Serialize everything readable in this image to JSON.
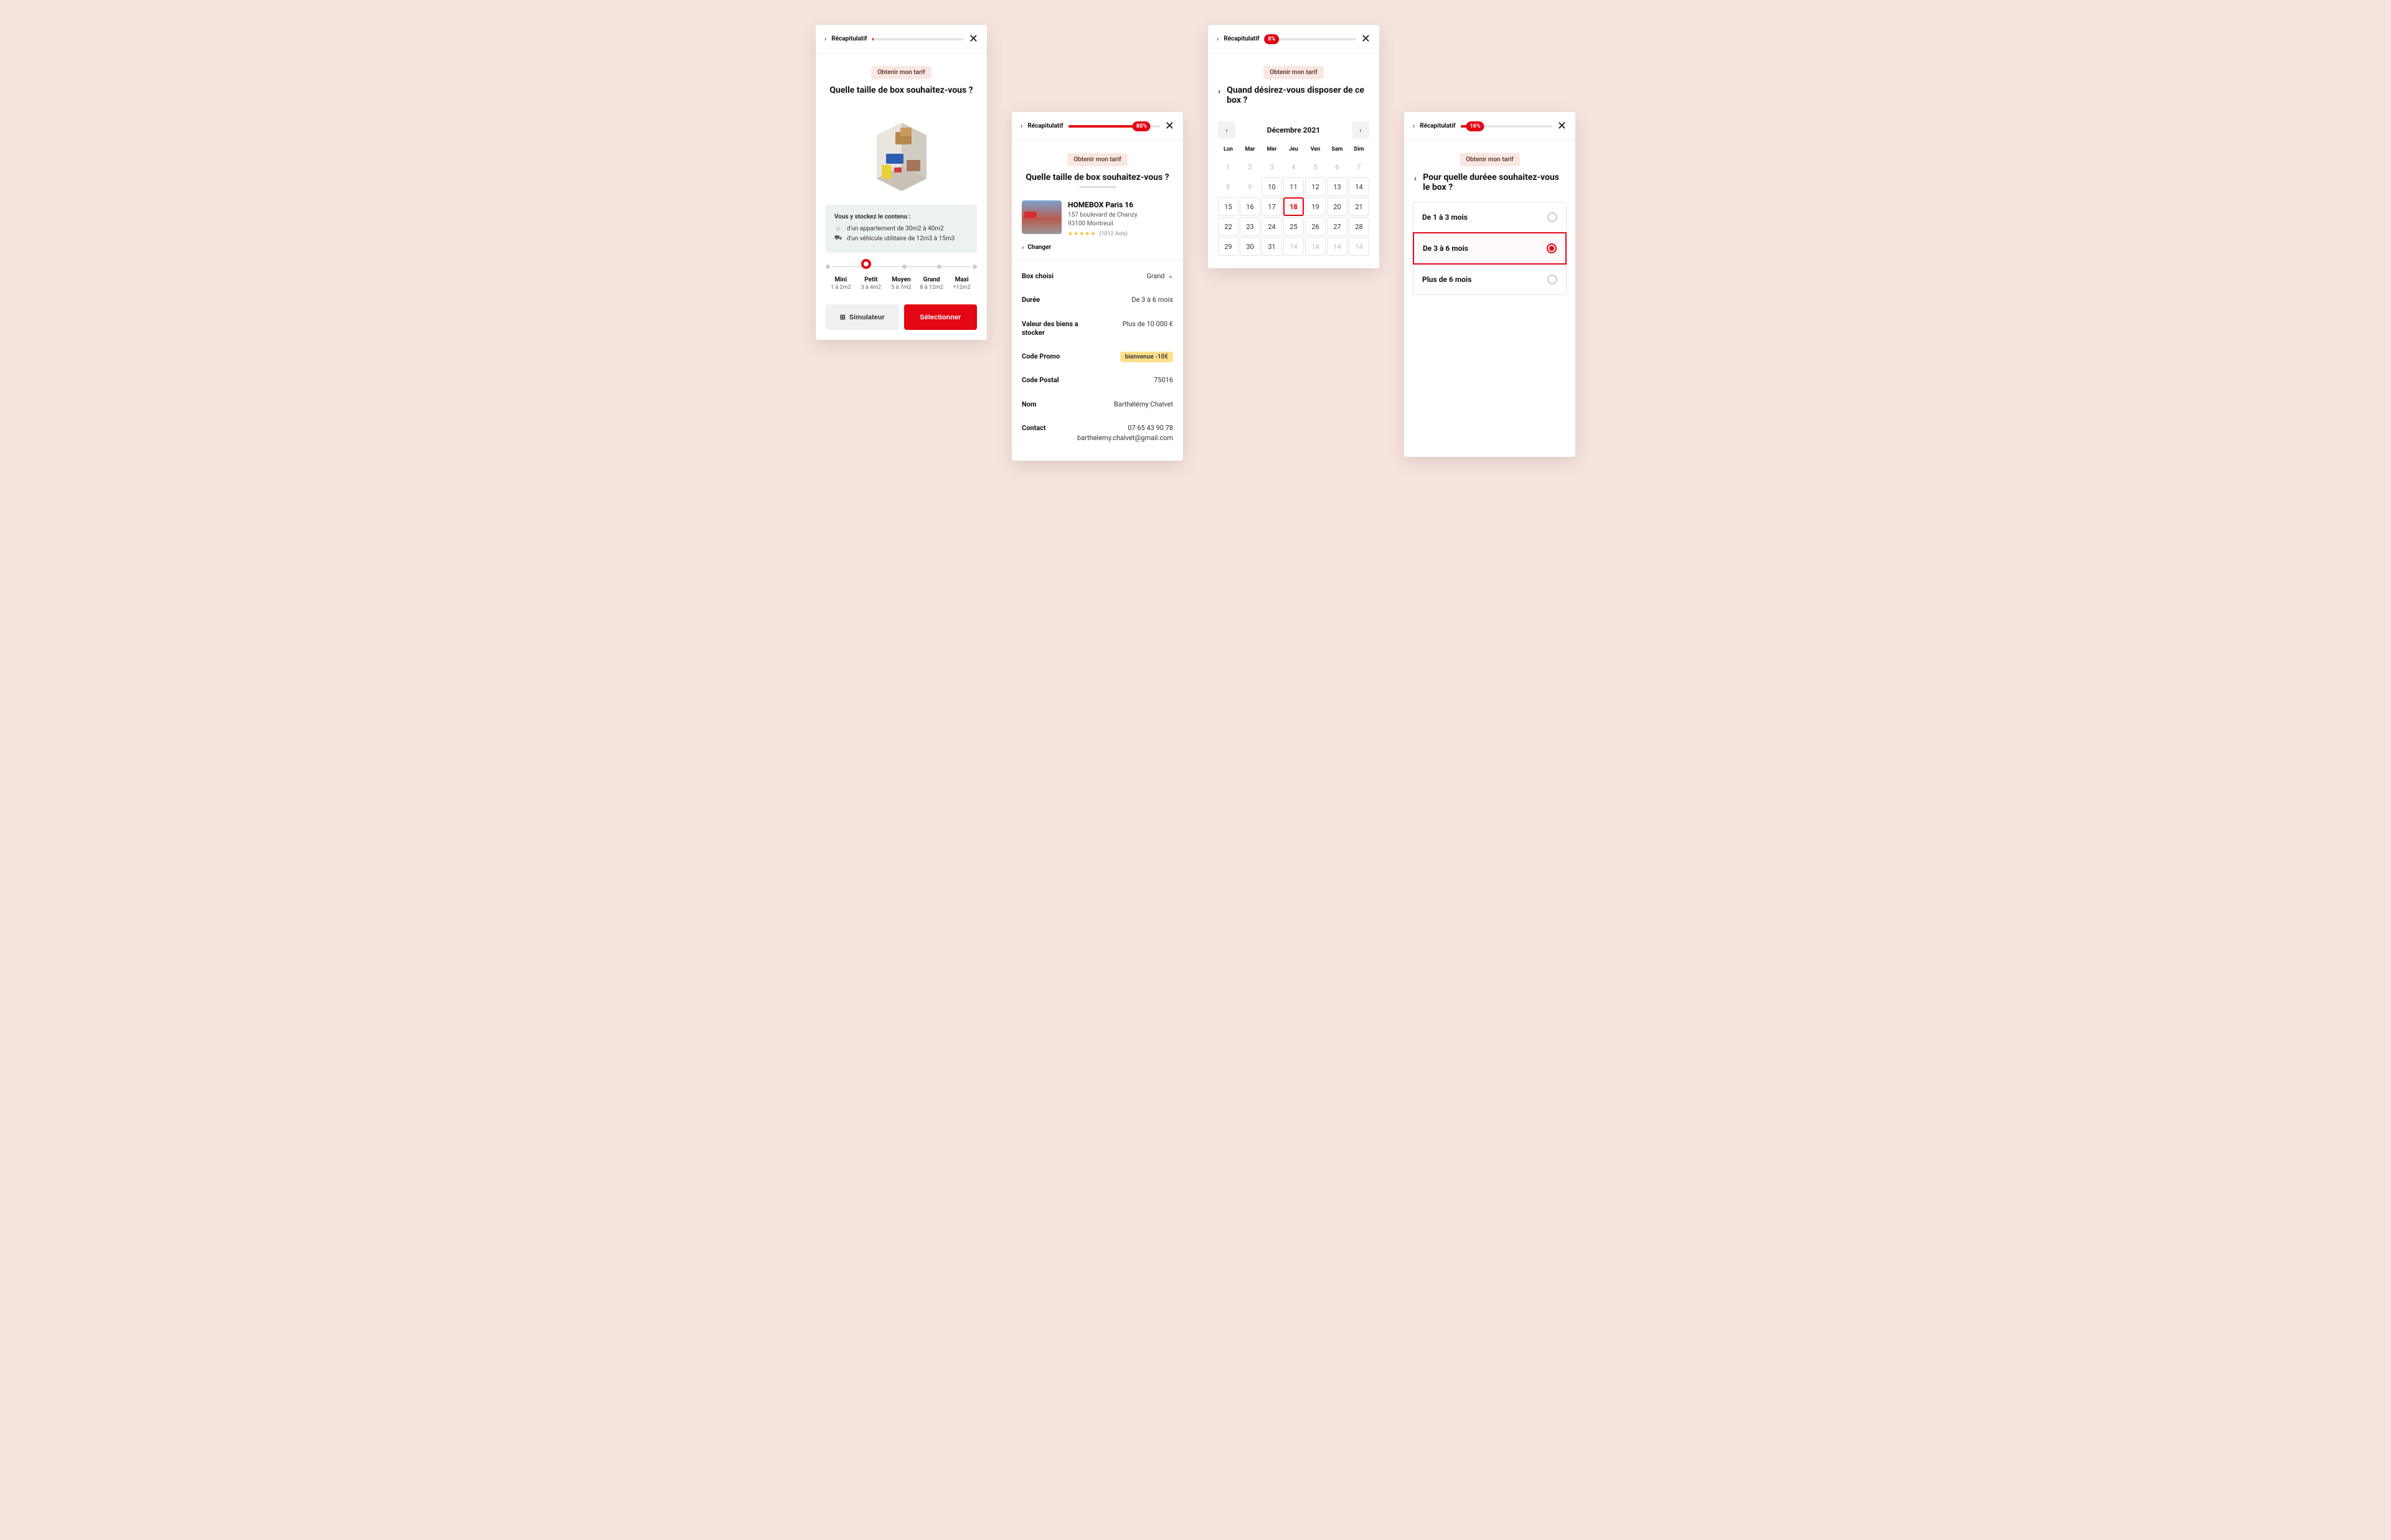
{
  "common": {
    "recap": "Récapitulatif",
    "pill": "Obtenir mon tarif",
    "close": "✕"
  },
  "screen1": {
    "title": "Quelle taille de box souhaitez-vous ?",
    "info_head": "Vous y stockez le contenu  :",
    "info_line1": "d'un appartement de 30m2 à 40m2",
    "info_line2": "d'un véhicule utilitaire de 12m3 à 15m3",
    "slider": [
      {
        "t": "Mini",
        "s": "1 à 2m2"
      },
      {
        "t": "Petit",
        "s": "3 à 4m2"
      },
      {
        "t": "Moyen",
        "s": "5 à 7m2"
      },
      {
        "t": "Grand",
        "s": "8 à 12m2"
      },
      {
        "t": "Maxi",
        "s": "+12m2"
      }
    ],
    "slider_active": 1,
    "simulator": "Simulateur",
    "select": "Sélectionner"
  },
  "screen2": {
    "progress_pct": "80%",
    "progress_badge": "80%",
    "title": "Quelle taille de box souhaitez-vous ?",
    "store_name": "HOMEBOX Paris 16",
    "addr1": "157 boulevard de Chanzy",
    "addr2": "93100 Montreuil",
    "stars": "★★★★★",
    "reviews": "(1012 Avis)",
    "change": "Changer",
    "rows": {
      "box_key": "Box choisi",
      "box_val": "Grand",
      "dur_key": "Durée",
      "dur_val": "De 3 à 6 mois",
      "valeur_key": "Valeur des biens a stocker",
      "valeur_val": "Plus de 10 000 €",
      "promo_key": "Code Promo",
      "promo_val": "bienvenue -10€",
      "postal_key": "Code Postal",
      "postal_val": "75016",
      "nom_key": "Nom",
      "nom_val": "Barthélémy Chalvet",
      "contact_key": "Contact",
      "contact_phone": "07 65 43 90 78",
      "contact_email": "barthelemy.chalvet@gmail.com"
    }
  },
  "screen3": {
    "progress_pct": "8%",
    "progress_badge": "8%",
    "title": "Quand désirez-vous disposer de ce box ?",
    "month": "Décembre 2021",
    "dow": [
      "Lun",
      "Mar",
      "Mer",
      "Jeu",
      "Ven",
      "Sam",
      "Dim"
    ],
    "weeks": [
      [
        {
          "n": "1",
          "m": 1
        },
        {
          "n": "2",
          "m": 1
        },
        {
          "n": "3",
          "m": 1
        },
        {
          "n": "4",
          "m": 1
        },
        {
          "n": "5",
          "m": 1
        },
        {
          "n": "6",
          "m": 1
        },
        {
          "n": "7",
          "m": 1
        }
      ],
      [
        {
          "n": "8",
          "m": 1
        },
        {
          "n": "9",
          "m": 1
        },
        {
          "n": "10",
          "b": 1
        },
        {
          "n": "11",
          "b": 1
        },
        {
          "n": "12",
          "b": 1
        },
        {
          "n": "13",
          "b": 1
        },
        {
          "n": "14",
          "b": 1
        }
      ],
      [
        {
          "n": "15",
          "b": 1
        },
        {
          "n": "16",
          "b": 1
        },
        {
          "n": "17",
          "b": 1
        },
        {
          "n": "18",
          "b": 1,
          "sel": 1
        },
        {
          "n": "19",
          "b": 1
        },
        {
          "n": "20",
          "b": 1
        },
        {
          "n": "21",
          "b": 1
        }
      ],
      [
        {
          "n": "22",
          "b": 1
        },
        {
          "n": "23",
          "b": 1
        },
        {
          "n": "24",
          "b": 1
        },
        {
          "n": "25",
          "b": 1
        },
        {
          "n": "26",
          "b": 1
        },
        {
          "n": "27",
          "b": 1
        },
        {
          "n": "28",
          "b": 1
        }
      ],
      [
        {
          "n": "29",
          "b": 1
        },
        {
          "n": "30",
          "b": 1
        },
        {
          "n": "31",
          "b": 1
        },
        {
          "n": "14",
          "b": 1,
          "m": 1
        },
        {
          "n": "14",
          "b": 1,
          "m": 1
        },
        {
          "n": "14",
          "b": 1,
          "m": 1
        },
        {
          "n": "14",
          "b": 1,
          "m": 1
        }
      ]
    ]
  },
  "screen4": {
    "progress_pct": "16%",
    "progress_badge": "16%",
    "title": "Pour quelle duréee souhaitez-vous le box ?",
    "options": [
      {
        "label": "De 1 à 3 mois",
        "sel": false
      },
      {
        "label": "De 3 à 6 mois",
        "sel": true
      },
      {
        "label": "Plus de 6 mois",
        "sel": false
      }
    ]
  }
}
